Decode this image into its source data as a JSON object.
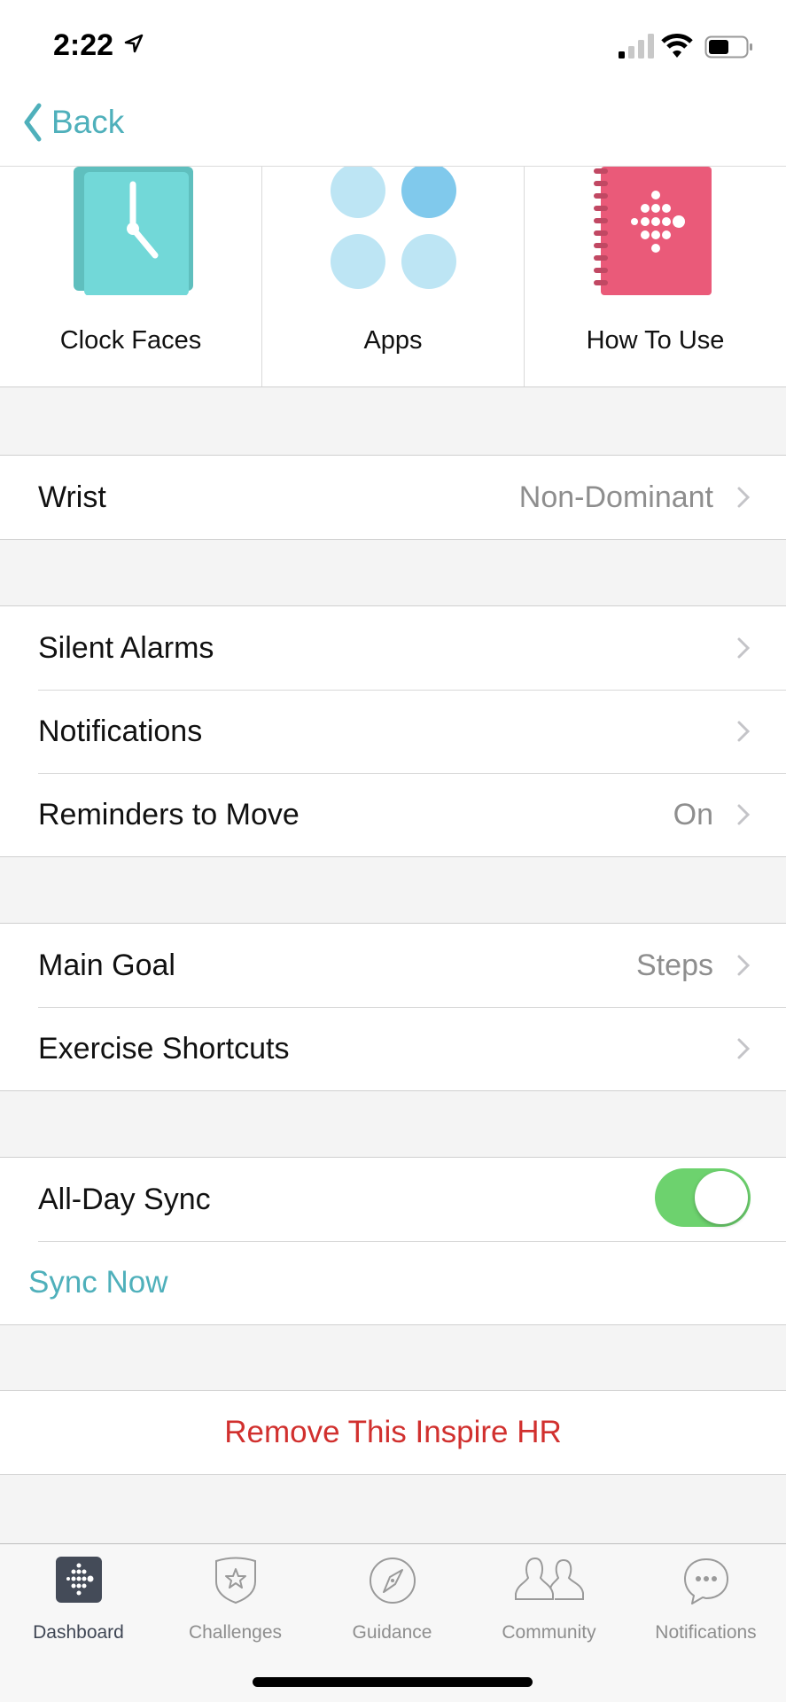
{
  "status_bar": {
    "time": "2:22",
    "location_icon": "location-arrow-icon",
    "signal_icon": "cellular-signal-icon",
    "wifi_icon": "wifi-icon",
    "battery_icon": "battery-icon"
  },
  "nav": {
    "back_label": "Back"
  },
  "tiles": [
    {
      "label": "Clock Faces",
      "icon": "clock-faces-icon",
      "color": "#72d8d8"
    },
    {
      "label": "Apps",
      "icon": "apps-icon",
      "color": "#bde5f4"
    },
    {
      "label": "How To Use",
      "icon": "manual-book-icon",
      "color": "#ea5a79"
    }
  ],
  "sections": {
    "wrist": {
      "label": "Wrist",
      "value": "Non-Dominant"
    },
    "alerts": [
      {
        "label": "Silent Alarms",
        "value": ""
      },
      {
        "label": "Notifications",
        "value": ""
      },
      {
        "label": "Reminders to Move",
        "value": "On"
      }
    ],
    "goals": [
      {
        "label": "Main Goal",
        "value": "Steps"
      },
      {
        "label": "Exercise Shortcuts",
        "value": ""
      }
    ],
    "sync": {
      "all_day_label": "All-Day Sync",
      "all_day_on": true,
      "sync_now_label": "Sync Now"
    },
    "remove": {
      "label": "Remove This Inspire HR"
    }
  },
  "colors": {
    "accent": "#4fb0bb",
    "danger": "#d1302e",
    "toggle_on": "#6dd26e"
  },
  "tabbar": [
    {
      "label": "Dashboard",
      "icon": "dashboard-icon",
      "active": true
    },
    {
      "label": "Challenges",
      "icon": "challenges-badge-icon",
      "active": false
    },
    {
      "label": "Guidance",
      "icon": "compass-icon",
      "active": false
    },
    {
      "label": "Community",
      "icon": "community-people-icon",
      "active": false
    },
    {
      "label": "Notifications",
      "icon": "chat-bubble-icon",
      "active": false
    }
  ]
}
